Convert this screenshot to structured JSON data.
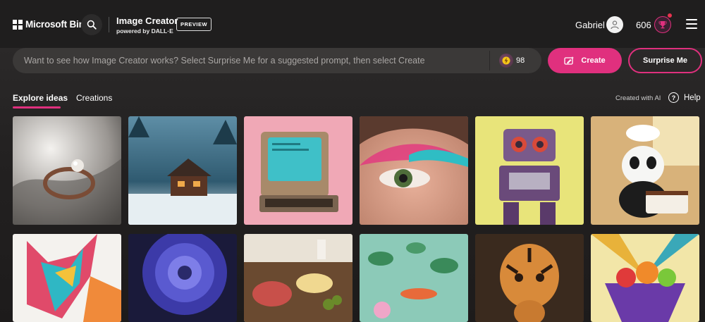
{
  "header": {
    "brand": "Microsoft Bing",
    "app_title": "Image Creator",
    "app_subtitle": "powered by DALL·E",
    "badge": "PREVIEW",
    "user_name": "Gabriel",
    "reward_points": "606"
  },
  "prompt": {
    "placeholder": "Want to see how Image Creator works? Select Surprise Me for a suggested prompt, then select Create",
    "boosts": "98"
  },
  "actions": {
    "create_label": "Create",
    "surprise_label": "Surprise Me"
  },
  "tabs": [
    {
      "label": "Explore ideas",
      "active": true
    },
    {
      "label": "Creations",
      "active": false
    }
  ],
  "meta": {
    "created_with_ai": "Created with AI",
    "help_label": "Help"
  },
  "gallery": [
    {
      "subject": "pearl ring on fabric"
    },
    {
      "subject": "snowy cabin in forest"
    },
    {
      "subject": "retro computer"
    },
    {
      "subject": "eye with colorful makeup"
    },
    {
      "subject": "vintage robot"
    },
    {
      "subject": "panda baking a cake"
    },
    {
      "subject": "paper art wolf"
    },
    {
      "subject": "blue dahlia flower"
    },
    {
      "subject": "charcuterie board"
    },
    {
      "subject": "koi pond with lily pads"
    },
    {
      "subject": "tiger sculptures"
    },
    {
      "subject": "geometric fruit bowl"
    }
  ],
  "colors": {
    "accent": "#e0307e",
    "background": "#1b1a1a",
    "prompt_bg": "#3b3938"
  },
  "icons": [
    "ms-logo-icon",
    "search-icon",
    "user-icon",
    "trophy-icon",
    "menu-icon",
    "boost-icon",
    "create-icon",
    "help-icon"
  ]
}
